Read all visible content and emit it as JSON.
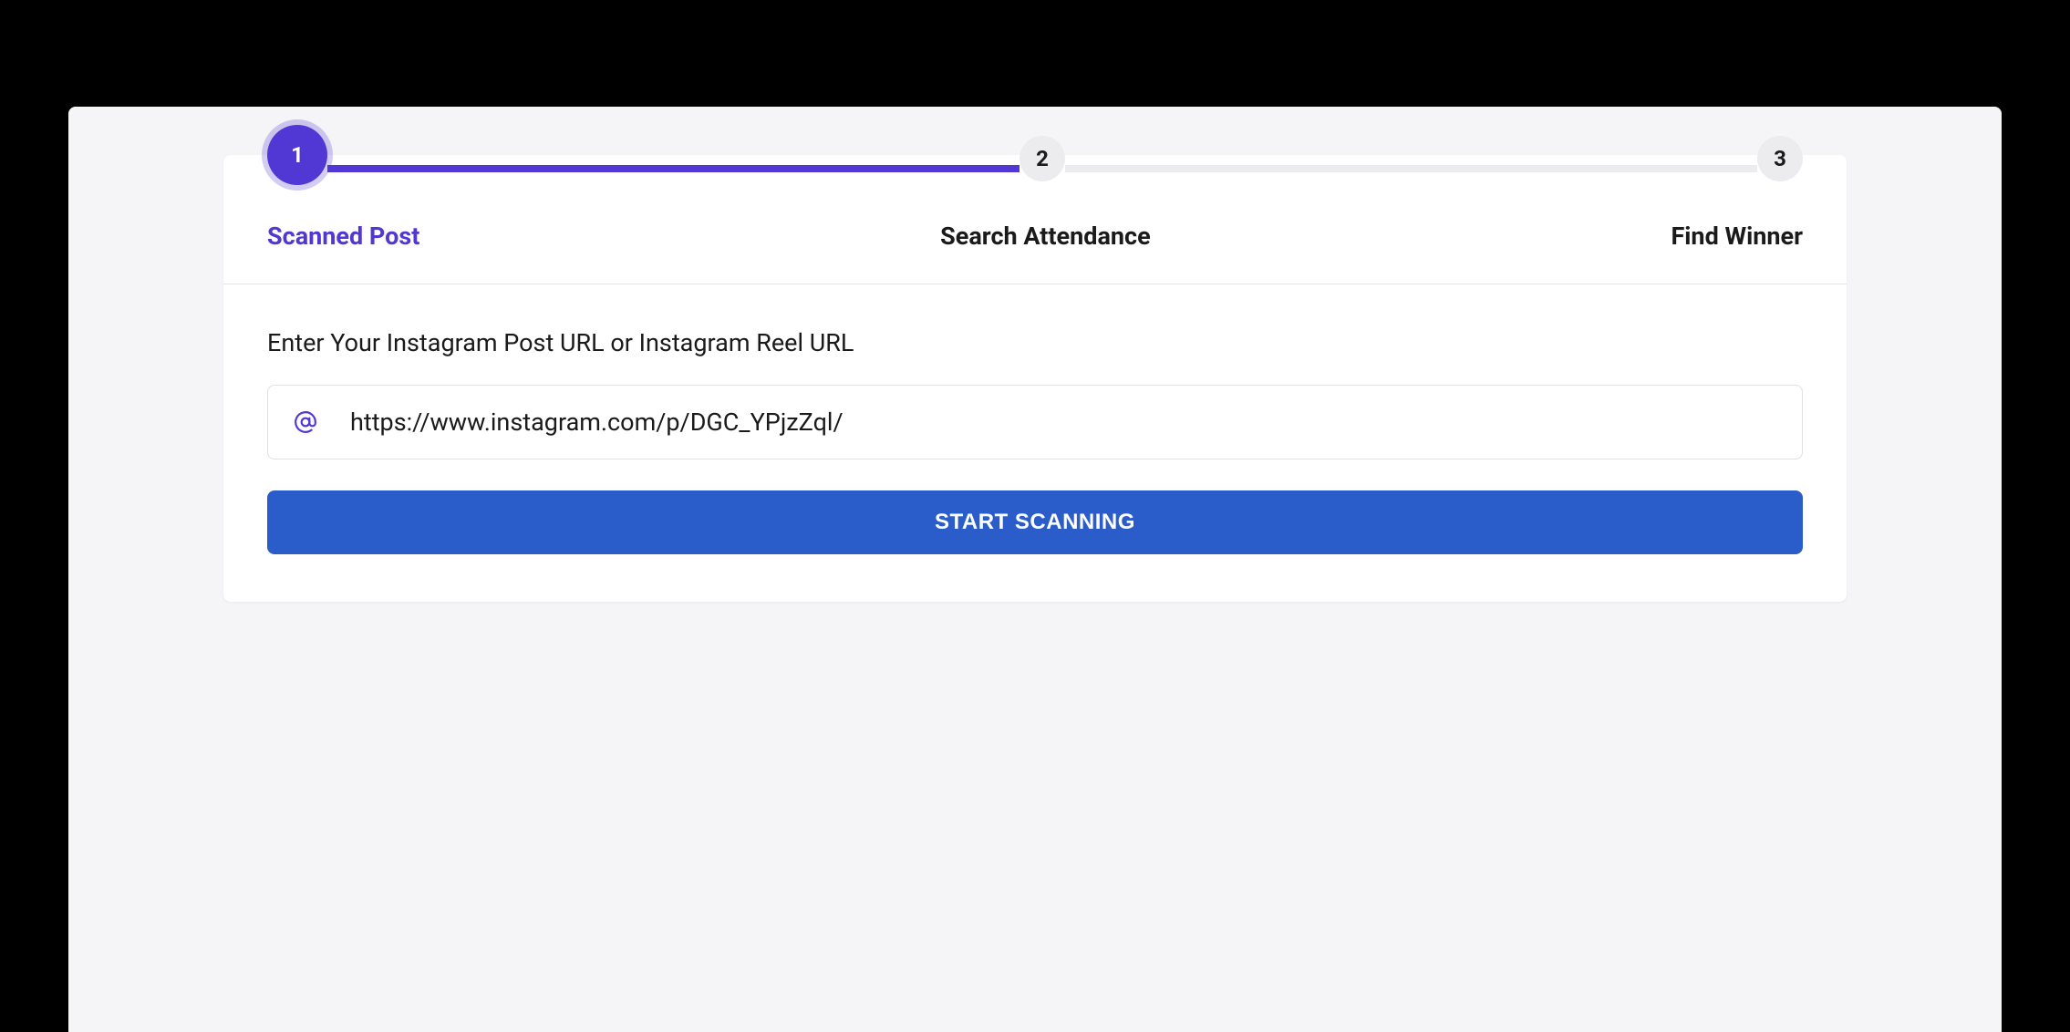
{
  "stepper": {
    "steps": [
      {
        "number": "1",
        "label": "Scanned Post",
        "active": true
      },
      {
        "number": "2",
        "label": "Search Attendance",
        "active": false
      },
      {
        "number": "3",
        "label": "Find Winner",
        "active": false
      }
    ]
  },
  "form": {
    "instruction": "Enter Your Instagram Post URL or Instagram Reel URL",
    "url_value": "https://www.instagram.com/p/DGC_YPjzZql/",
    "button_label": "START SCANNING"
  },
  "colors": {
    "primary": "#5138d4",
    "button": "#2a5dc9",
    "inactive_bg": "#ececef"
  }
}
